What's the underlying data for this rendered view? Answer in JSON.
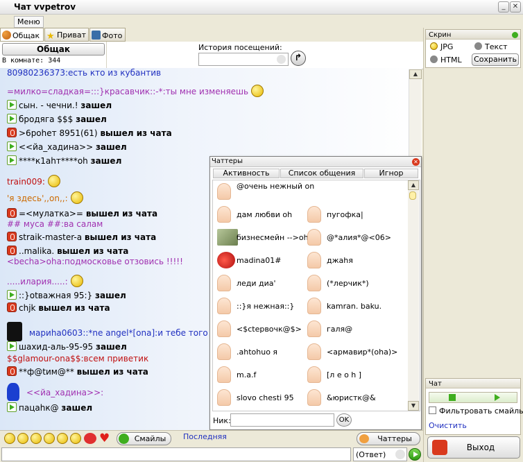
{
  "window": {
    "title": "Чат vvpetrov",
    "menu": "Меню"
  },
  "tabs": [
    {
      "label": "Общак",
      "icon": "people-icon"
    },
    {
      "label": "Приват",
      "icon": "star-icon"
    },
    {
      "label": "Фото",
      "icon": "camera-icon"
    }
  ],
  "room": {
    "name": "Общак",
    "count_label": "В комнате: 344",
    "history_label": "История посещений:",
    "history_value": ""
  },
  "colors": {
    "system": "#000000",
    "blue": "#2030c0",
    "red": "#c01010",
    "purple": "#a030b0",
    "orange": "#cc6a00",
    "green_arrow": "#3fae1f",
    "exit_red": "#d9391d"
  },
  "messages": [
    {
      "kind": "text",
      "color": "#2030c0",
      "text": "80980236373:есть кто из кубантив"
    },
    {
      "kind": "text",
      "color": "#a030b0",
      "text": "=милко=сладкая=:::}красавчик::-*:ты мне изменяешь",
      "emoticon": "laughing-smiley-icon"
    },
    {
      "kind": "enter",
      "name": "сын. - чечни.!",
      "action": "зашел"
    },
    {
      "kind": "enter",
      "name": "бродяга $$$",
      "action": "зашел"
    },
    {
      "kind": "exit",
      "name": ">6рoheт 8951(61)",
      "action": "вышел из чата"
    },
    {
      "kind": "enter",
      "name": "<<йа_хадина>>",
      "action": "зашел"
    },
    {
      "kind": "enter",
      "name": "****к1аhт****oh",
      "action": "зашел"
    },
    {
      "kind": "text",
      "color": "#c01010",
      "text": "train009:",
      "emoticon": "bomb-smiley-icon"
    },
    {
      "kind": "text",
      "color": "#cc6a00",
      "text": "'я здесь',,on,,:",
      "emoticon": "suspicious-smiley-icon"
    },
    {
      "kind": "exit",
      "name": "=<мулатка>=",
      "action": "вышел из чата"
    },
    {
      "kind": "text",
      "color": "#a030b0",
      "text": "##     муса     ##:ва салам"
    },
    {
      "kind": "exit",
      "name": "straik-master-a",
      "action": "вышел из чата"
    },
    {
      "kind": "exit",
      "name": "..malika.",
      "action": "вышел из чата"
    },
    {
      "kind": "text",
      "color": "#a030b0",
      "text": "<becha>oha:подмосковье отзовись !!!!!"
    },
    {
      "kind": "text",
      "color": "#a030b0",
      "text": ".....илария.....:",
      "emoticon": "grin-smiley-icon"
    },
    {
      "kind": "enter",
      "name": "::}otважная 95:}",
      "action": "зашел"
    },
    {
      "kind": "exit",
      "name": "chjk",
      "action": "вышел из чата"
    },
    {
      "kind": "text",
      "color": "#2030c0",
      "text": "мариhа0603::*ne angel*[ona]:и тебе того :",
      "emoticon": "black-cat-icon"
    },
    {
      "kind": "enter",
      "name": "шахид-аль-95-95",
      "action": "зашел"
    },
    {
      "kind": "text",
      "color": "#c01010",
      "text": "$$glamour-ona$$:всем приветик"
    },
    {
      "kind": "exit",
      "name": "**ф@tим@**",
      "action": "вышел из чата"
    },
    {
      "kind": "text",
      "color": "#a030b0",
      "text": "<<йа_хадина>>:",
      "emoticon": "playboy-bunny-icon"
    },
    {
      "kind": "enter",
      "name": "пацаhк@",
      "action": "зашел"
    }
  ],
  "chatters": {
    "title": "Чаттеры",
    "tabs": [
      "Активность",
      "Список общения",
      "Игнор"
    ],
    "left": [
      "@очень нежный on",
      "дам любви oh",
      "бизнесмейн -->oh",
      "madina01#",
      "леди диа'",
      "::}я нежная::}",
      "<$ctepвочк@$>",
      ".ahtohuo  я",
      "m.a.f",
      "slovo chesti 95"
    ],
    "right": [
      "",
      "пугофка|",
      "@*алия*@<06>",
      "джаhя",
      "(*лерчик*)",
      "kamran. baku.",
      "галя@",
      "<армавир*(oha)>",
      "[л е о h ]",
      "&юристк@&"
    ],
    "nick_label": "Ник:",
    "nick_value": "",
    "ok": "OK"
  },
  "bottom": {
    "smileys_button": "Смайлы",
    "last_label": "Последняя",
    "chatters_button": "Чаттеры",
    "answer_label": "(Ответ)",
    "message_value": ""
  },
  "screen": {
    "title": "Скрин",
    "jpg": "JPG",
    "text": "Текст",
    "html": "HTML",
    "save": "Сохранить"
  },
  "chat_panel": {
    "title": "Чат",
    "filter": "Фильтровать смайлы",
    "clear": "Очистить"
  },
  "exit_button": "Выход"
}
